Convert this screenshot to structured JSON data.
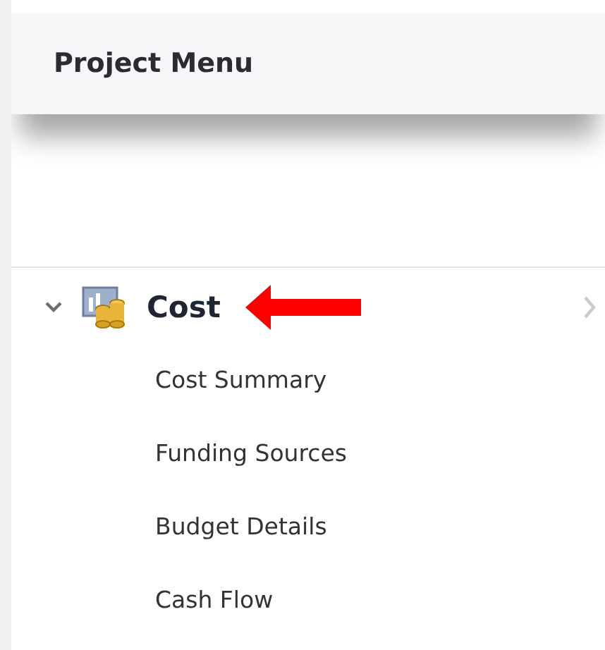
{
  "header": {
    "title": "Project Menu"
  },
  "section": {
    "label": "Cost",
    "expanded": true,
    "items": [
      {
        "label": "Cost Summary"
      },
      {
        "label": "Funding Sources"
      },
      {
        "label": "Budget Details"
      },
      {
        "label": "Cash Flow"
      }
    ]
  }
}
